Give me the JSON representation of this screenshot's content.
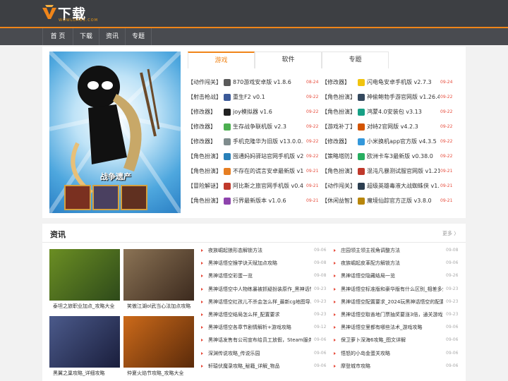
{
  "brand": {
    "name": "下载王",
    "sub": "WOWLOADS.COM",
    "accent": "#f08519"
  },
  "nav": [
    "首 页",
    "下载",
    "资讯",
    "专题"
  ],
  "hero": {
    "caption": "战争遗产"
  },
  "tabs": [
    "游戏",
    "软件",
    "专题"
  ],
  "games_left": [
    {
      "cat": "【动作闯关】",
      "name": "870游戏安卓版 v1.8.6",
      "date": "08-24",
      "icon": "#5a5a5a"
    },
    {
      "cat": "【射击枪战】",
      "name": "重生F2 v0.1",
      "date": "09-22",
      "icon": "#3b5998"
    },
    {
      "cat": "【修改器】",
      "name": "joy模拟器 v1.6",
      "date": "09-22",
      "icon": "#222222"
    },
    {
      "cat": "【修改器】",
      "name": "生存战争联机版 v2.3",
      "date": "09-22",
      "icon": "#4caf50"
    },
    {
      "cat": "【修改器】",
      "name": "手机克隆华为旧版 v13.0.0.340",
      "date": "09-22",
      "icon": "#7f8c8d"
    },
    {
      "cat": "【角色扮演】",
      "name": "囤通妈妈驿站官网手机版 v2.9.1",
      "date": "09-22",
      "icon": "#2980b9"
    },
    {
      "cat": "【角色扮演】",
      "name": "不存在的谎言安卓最新版 v1.0.6",
      "date": "09-21",
      "icon": "#e67e22"
    },
    {
      "cat": "【冒险解谜】",
      "name": "阿比斯之旅官网手机版 v0.4.5",
      "date": "09-21",
      "icon": "#c0392b"
    },
    {
      "cat": "【角色扮演】",
      "name": "行界最新版本 v1.0.6",
      "date": "09-21",
      "icon": "#8e44ad"
    }
  ],
  "games_right": [
    {
      "cat": "【修改器】",
      "name": "闪电龟安卓手机版 v2.7.3",
      "date": "09-24",
      "icon": "#f1c40f"
    },
    {
      "cat": "【角色扮演】",
      "name": "神偷鲍勃手游官网版 v1.26.4",
      "date": "09-22",
      "icon": "#34495e"
    },
    {
      "cat": "【角色扮演】",
      "name": "鸿蒙4.0安装包 v3.13",
      "date": "09-22",
      "icon": "#16a085"
    },
    {
      "cat": "【游戏补丁】",
      "name": "对峙2官网版 v4.2.3",
      "date": "09-22",
      "icon": "#d35400"
    },
    {
      "cat": "【修改器】",
      "name": "小米换机app官方版 v4.3.5",
      "date": "09-22",
      "icon": "#3498db"
    },
    {
      "cat": "【策略塔防】",
      "name": "欧洲卡车3最新版 v0.38.0",
      "date": "09-22",
      "icon": "#27ae60"
    },
    {
      "cat": "【角色扮演】",
      "name": "混沌凡暴测试服官网版 v1.21.0",
      "date": "09-21",
      "icon": "#c0392b"
    },
    {
      "cat": "【动作闯关】",
      "name": "超级英雄毒液大战蜘蛛侠 v1.0",
      "date": "09-21",
      "icon": "#2c3e50"
    },
    {
      "cat": "【休闲益智】",
      "name": "魔境仙踪官方正版 v3.8.0",
      "date": "09-21",
      "icon": "#b8860b"
    }
  ],
  "news_section": {
    "title": "资讯",
    "more": "更多 〉"
  },
  "thumbs": [
    {
      "caption": "泰坦之旅职业加点_攻略大全",
      "c1": "#6b8e23",
      "c2": "#2e4a1a"
    },
    {
      "caption": "笑傲江湖ol武当心法加点攻略",
      "c1": "#8b7355",
      "c2": "#3c2a1e"
    },
    {
      "caption": "黑翼之巢攻略_详细攻略",
      "c1": "#4b5a8b",
      "c2": "#1a1e3c"
    },
    {
      "caption": "仲夏火焰节攻略_攻略大全",
      "c1": "#cc6a1a",
      "c2": "#5a2a0a"
    }
  ],
  "news_left": [
    {
      "title": "夜族崛起狼形态解锁方法",
      "date": "09-06"
    },
    {
      "title": "黑神话悟空猴学诀天赋加点攻略",
      "date": "09-08"
    },
    {
      "title": "黑神话悟空彩蛋一览",
      "date": "09-08"
    },
    {
      "title": "黑神话悟空中人物练暴被抓疑扮装原作_黑神话悟空",
      "date": "09-23"
    },
    {
      "title": "黑神话悟空红孩儿不杀会怎么样_最新cg地图导...",
      "date": "09-23"
    },
    {
      "title": "黑神话悟空结局怎么样_配置要求",
      "date": "09-23"
    },
    {
      "title": "黑神话悟空各章节剧情解析+游戏攻略",
      "date": "09-12"
    },
    {
      "title": "黑神话发售有公司宣布给员工放假，Steam服务器...",
      "date": "09-06"
    },
    {
      "title": "深渊传说攻略_传说乐园",
      "date": "09-06"
    },
    {
      "title": "轩辕伏魔录攻略_秘籍_详解_物品",
      "date": "09-06"
    }
  ],
  "news_right": [
    {
      "title": "庄园领主领主视角调整方法",
      "date": "09-08"
    },
    {
      "title": "夜族崛起皮革配方解锁方法",
      "date": "09-06"
    },
    {
      "title": "黑神话悟空隐藏结局一览",
      "date": "09-26"
    },
    {
      "title": "黑神话悟空标准版和豪华版有什么区别_相差多少",
      "date": "09-23"
    },
    {
      "title": "黑神话悟空配置要求_2024玩黑神话悟空的配置推荐",
      "date": "09-23"
    },
    {
      "title": "黑神话悟空取善地门票抽奖要涨3倍，通关游戏...",
      "date": "09-23"
    },
    {
      "title": "黑神话悟空里都有哪些法术_游戏攻略",
      "date": "09-06"
    },
    {
      "title": "保卫萝卜深海6攻略_图文详解",
      "date": "09-06"
    },
    {
      "title": "悟怒的小岛金蛋关攻略",
      "date": "09-06"
    },
    {
      "title": "摩登城市攻略",
      "date": "09-06"
    }
  ]
}
